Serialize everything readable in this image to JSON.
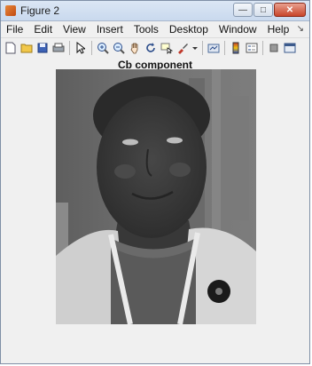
{
  "window": {
    "title": "Figure 2"
  },
  "menu": [
    "File",
    "Edit",
    "View",
    "Insert",
    "Tools",
    "Desktop",
    "Window",
    "Help"
  ],
  "toolbar": {
    "icons": [
      "new-file-icon",
      "open-folder-icon",
      "save-icon",
      "print-icon",
      "pointer-icon",
      "zoom-in-icon",
      "zoom-out-icon",
      "pan-hand-icon",
      "rotate-3d-icon",
      "data-cursor-icon",
      "brush-icon",
      "link-plot-icon",
      "colorbar-icon",
      "legend-icon",
      "hide-tools-icon",
      "show-tools-icon"
    ]
  },
  "figure": {
    "title": "Cb component",
    "image_description_colors": {
      "background": "#6f6f6f",
      "face": "#3a3a3a",
      "jacket": "#d8d8d8",
      "sweater": "#595959"
    }
  }
}
